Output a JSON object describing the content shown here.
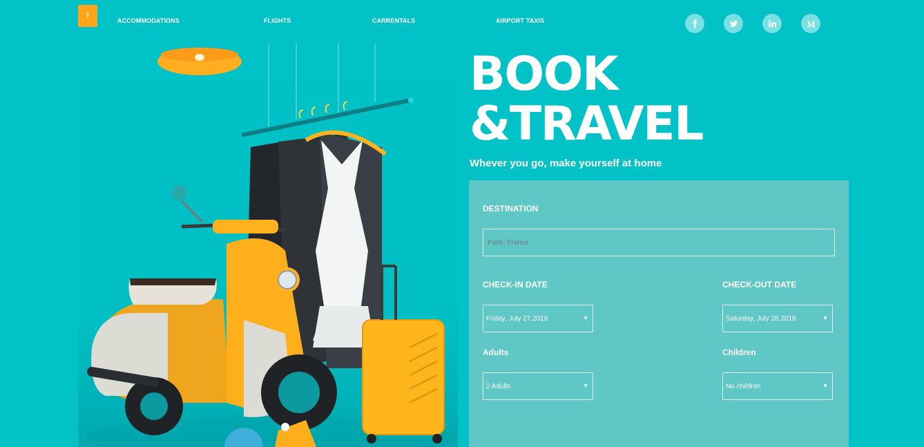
{
  "header": {
    "logo_letter": "T",
    "nav": [
      "ACCOMMODATIONS",
      "FLIGHTS",
      "CARRENTALS",
      "AIRPORT TAXIS"
    ],
    "social": [
      "facebook-icon",
      "twitter-icon",
      "linkedin-icon",
      "medium-icon"
    ]
  },
  "hero": {
    "title_line1": "BOOK",
    "title_line2": "&TRAVEL",
    "subtitle": "Whever you go, make yourself at home"
  },
  "form": {
    "destination_label": "DESTINATION",
    "destination_placeholder": "Paris, France",
    "checkin_label": "CHECK-IN DATE",
    "checkin_value": "Friday, July 27.2018",
    "checkout_label": "CHECK-OUT DATE",
    "checkout_value": "Saturday, July 28.2018",
    "adults_label": "Adults",
    "adults_value": "2 Adults",
    "children_label": "Children",
    "children_value": "No children",
    "caret": "▼"
  },
  "colors": {
    "background": "#00c2c7",
    "panel": "#5fc8c6",
    "accent": "#ffa41b"
  }
}
